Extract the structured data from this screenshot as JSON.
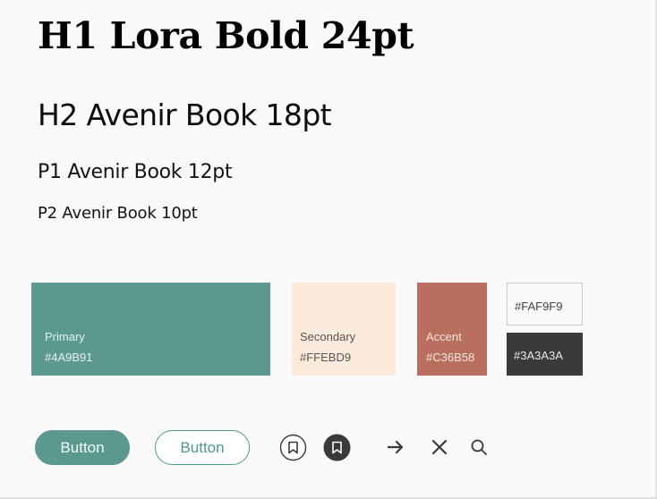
{
  "typography": {
    "h1": "H1 Lora Bold 24pt",
    "h2": "H2 Avenir Book 18pt",
    "p1": "P1 Avenir Book 12pt",
    "p2": "P2 Avenir Book 10pt"
  },
  "swatches": {
    "primary": {
      "name": "Primary",
      "hex": "#4A9B91",
      "color": "#5B9990"
    },
    "secondary": {
      "name": "Secondary",
      "hex": "#FFEBD9",
      "color": "#FCEBDD"
    },
    "accent": {
      "name": "Accent",
      "hex": "#C36B58",
      "color": "#B96F5E"
    },
    "light": {
      "hex": "#FAF9F9",
      "color": "#FAF9F9"
    },
    "dark": {
      "hex": "#3A3A3A",
      "color": "#3A3A3A"
    }
  },
  "buttons": {
    "filled_label": "Button",
    "outline_label": "Button",
    "accent_color": "#5B9990"
  },
  "icons": [
    "bookmark-outline-icon",
    "bookmark-filled-icon",
    "arrow-right-icon",
    "close-icon",
    "search-icon"
  ]
}
